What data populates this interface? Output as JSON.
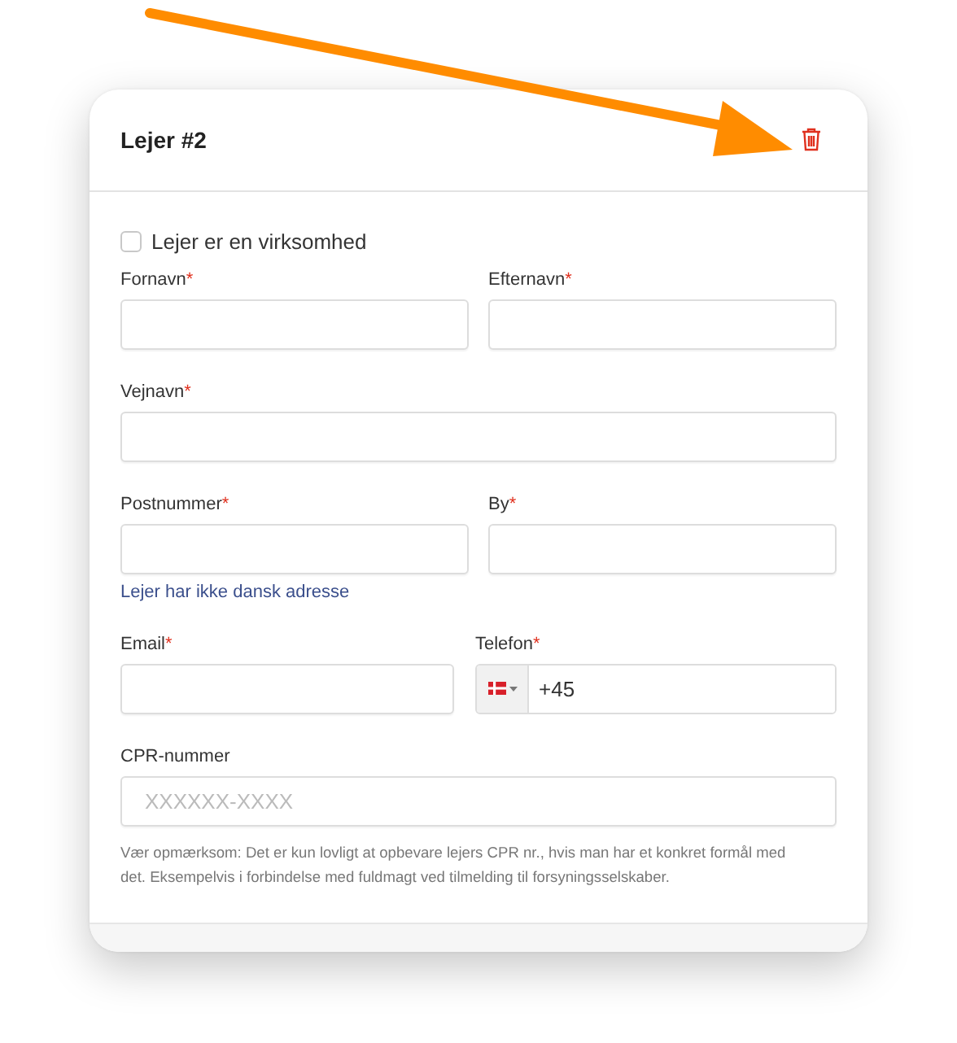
{
  "card": {
    "title": "Lejer #2"
  },
  "company_checkbox": {
    "label": "Lejer er en virksomhed",
    "checked": false
  },
  "required_mark": "*",
  "rows": [
    {
      "kind": "pair",
      "fields": [
        {
          "label": "Fornavn",
          "required": true,
          "kind": "text"
        },
        {
          "label": "Efternavn",
          "required": true,
          "kind": "text"
        }
      ]
    },
    {
      "kind": "single",
      "fields": [
        {
          "label": "Vejnavn",
          "required": true,
          "kind": "text"
        }
      ]
    },
    {
      "kind": "pair",
      "fields": [
        {
          "label": "Postnummer",
          "required": true,
          "kind": "text"
        },
        {
          "label": "By",
          "required": true,
          "kind": "text"
        }
      ],
      "link": "Lejer har ikke dansk adresse"
    },
    {
      "kind": "contact",
      "fields": [
        {
          "label": "Email",
          "required": true,
          "kind": "text"
        },
        {
          "label": "Telefon",
          "required": true,
          "kind": "phone",
          "value": "+45"
        }
      ]
    },
    {
      "kind": "single",
      "fields": [
        {
          "label": "CPR-nummer",
          "required": false,
          "kind": "text",
          "placeholder": "XXXXXX-XXXX"
        }
      ],
      "note": "Vær opmærksom: Det er kun lovligt at opbevare lejers CPR nr., hvis man har et konkret formål med det. Eksempelvis i forbindelse med fuldmagt ved tilmelding til forsyningsselskaber."
    }
  ]
}
